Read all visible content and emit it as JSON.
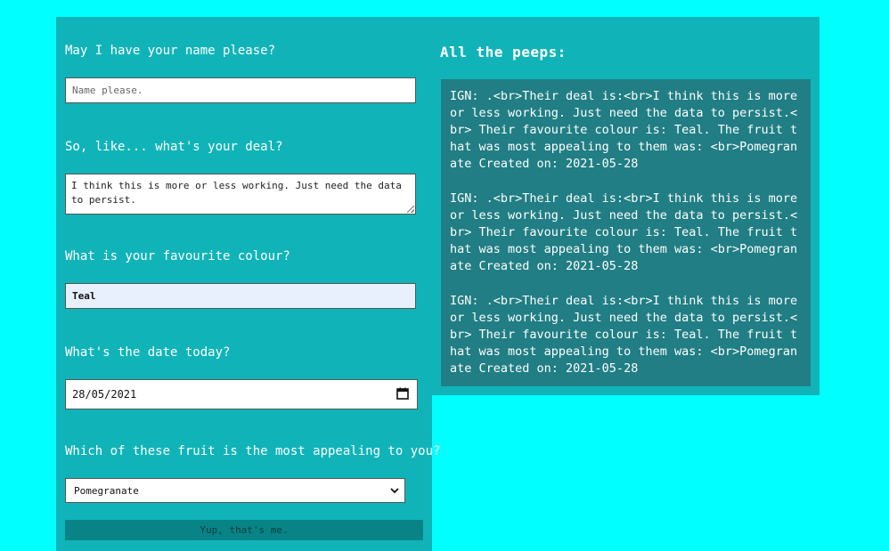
{
  "form": {
    "name_label": "May I have your name please?",
    "name_placeholder": "Name please.",
    "name_value": "",
    "deal_label": "So, like... what's your deal?",
    "deal_value": "I think this is more or less working. Just need the data to persist.",
    "colour_label": "What is your favourite colour?",
    "colour_value": "Teal",
    "date_label": "What's the date today?",
    "date_value": "28/05/2021",
    "fruit_label": "Which of these fruit is the most appealing to you?",
    "fruit_selected": "Pomegranate",
    "submit_label": "Yup, that's me."
  },
  "peeps": {
    "title": "All the peeps:",
    "entries": [
      "IGN: .<br>Their deal is:<br>I think this is more or less working. Just need the data to persist.<br> Their favourite colour is: Teal. The fruit that was most appealing to them was: <br>Pomegranate Created on: 2021-05-28",
      "IGN: .<br>Their deal is:<br>I think this is more or less working. Just need the data to persist.<br> Their favourite colour is: Teal. The fruit that was most appealing to them was: <br>Pomegranate Created on: 2021-05-28",
      "IGN: .<br>Their deal is:<br>I think this is more or less working. Just need the data to persist.<br> Their favourite colour is: Teal. The fruit that was most appealing to them was: <br>Pomegranate Created on: 2021-05-28"
    ]
  },
  "icons": {
    "calendar": "calendar-icon",
    "dropdown": "chevron-down-icon"
  },
  "colors": {
    "page_background": "#00ffff",
    "panel_background": "#10b4b8",
    "list_background": "#207e84",
    "button_background": "#088486",
    "colour_input_background": "#e8effd"
  }
}
